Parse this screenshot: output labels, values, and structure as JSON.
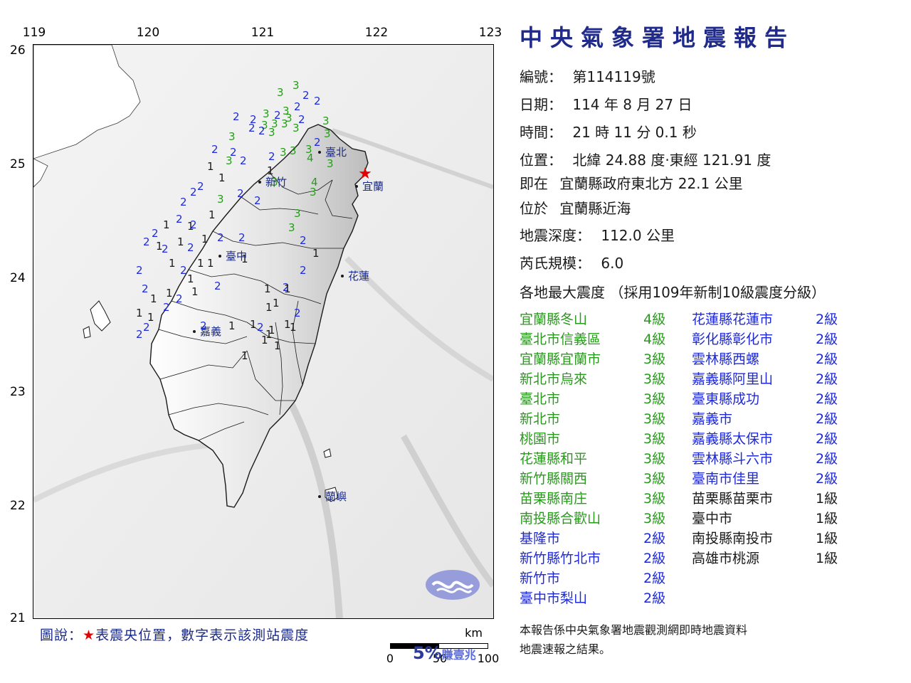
{
  "map": {
    "lon_ticks": [
      "119",
      "120",
      "121",
      "122",
      "123"
    ],
    "lat_ticks": [
      "26",
      "25",
      "24",
      "23",
      "22",
      "21"
    ],
    "caption_prefix": "圖說：",
    "caption_star": "★",
    "caption_text": "表震央位置，數字表示該測站震度",
    "scale_unit": "km",
    "scale_labels": [
      "0",
      "50",
      "100"
    ],
    "cities": [
      "臺北",
      "新竹",
      "宜蘭",
      "臺中",
      "花蓮",
      "嘉義",
      "蘭嶼"
    ],
    "station_values": [
      "3",
      "3",
      "2",
      "2",
      "2",
      "3",
      "3",
      "2",
      "3",
      "2",
      "3",
      "3",
      "3",
      "3",
      "3",
      "2",
      "2",
      "3",
      "2",
      "2",
      "3",
      "3",
      "2",
      "3",
      "3",
      "2",
      "3",
      "4",
      "3",
      "2",
      "2",
      "1",
      "1",
      "3",
      "2",
      "1",
      "2",
      "2",
      "3",
      "2",
      "1",
      "2",
      "2",
      "3",
      "3",
      "3",
      "4",
      "3",
      "1",
      "2",
      "2",
      "1",
      "2",
      "1",
      "1",
      "2",
      "2",
      "1",
      "2",
      "2",
      "1",
      "1",
      "2",
      "2",
      "1",
      "2",
      "1",
      "2",
      "1",
      "2",
      "1",
      "1",
      "2",
      "2",
      "2",
      "2",
      "1",
      "1",
      "1",
      "2",
      "2",
      "2",
      "1",
      "2",
      "1",
      "1",
      "1",
      "1",
      "1",
      "1",
      "2",
      "1",
      "1",
      "1",
      "1",
      "1",
      "1",
      "2",
      "1"
    ],
    "colors": {
      "level1": "#1a1a1a",
      "level2": "#1f2ad6",
      "level3": "#2a9a1e",
      "level4": "#2a9a1e",
      "epicenter": "#e30000"
    }
  },
  "report": {
    "title": "中央氣象署地震報告",
    "number_label": "編號：",
    "number": "第114119號",
    "date_label": "日期：",
    "date": "114 年 8 月 27 日",
    "time_label": "時間：",
    "time": "21 時 11 分 0.1 秒",
    "location_label": "位置：",
    "location": "北緯 24.88 度‧東經 121.91 度",
    "relative_label": "即在",
    "relative": "宜蘭縣政府東北方 22.1 公里",
    "region_label": "位於",
    "region": "宜蘭縣近海",
    "depth_label": "地震深度：",
    "depth": "112.0 公里",
    "magnitude_label": "芮氏規模：",
    "magnitude": "6.0",
    "intensity_title": "各地最大震度 （採用109年新制10級震度分級）",
    "intensities_col1": [
      {
        "place": "宜蘭縣冬山",
        "level": "4級",
        "color": "#2a9a1e"
      },
      {
        "place": "臺北市信義區",
        "level": "4級",
        "color": "#2a9a1e"
      },
      {
        "place": "宜蘭縣宜蘭市",
        "level": "3級",
        "color": "#2a9a1e"
      },
      {
        "place": "新北市烏來",
        "level": "3級",
        "color": "#2a9a1e"
      },
      {
        "place": "臺北市",
        "level": "3級",
        "color": "#2a9a1e"
      },
      {
        "place": "新北市",
        "level": "3級",
        "color": "#2a9a1e"
      },
      {
        "place": "桃園市",
        "level": "3級",
        "color": "#2a9a1e"
      },
      {
        "place": "花蓮縣和平",
        "level": "3級",
        "color": "#2a9a1e"
      },
      {
        "place": "新竹縣關西",
        "level": "3級",
        "color": "#2a9a1e"
      },
      {
        "place": "苗栗縣南庄",
        "level": "3級",
        "color": "#2a9a1e"
      },
      {
        "place": "南投縣合歡山",
        "level": "3級",
        "color": "#2a9a1e"
      },
      {
        "place": "基隆市",
        "level": "2級",
        "color": "#1f2ad6"
      },
      {
        "place": "新竹縣竹北市",
        "level": "2級",
        "color": "#1f2ad6"
      },
      {
        "place": "新竹市",
        "level": "2級",
        "color": "#1f2ad6"
      },
      {
        "place": "臺中市梨山",
        "level": "2級",
        "color": "#1f2ad6"
      }
    ],
    "intensities_col2": [
      {
        "place": "花蓮縣花蓮市",
        "level": "2級",
        "color": "#1f2ad6"
      },
      {
        "place": "彰化縣彰化市",
        "level": "2級",
        "color": "#1f2ad6"
      },
      {
        "place": "雲林縣西螺",
        "level": "2級",
        "color": "#1f2ad6"
      },
      {
        "place": "嘉義縣阿里山",
        "level": "2級",
        "color": "#1f2ad6"
      },
      {
        "place": "臺東縣成功",
        "level": "2級",
        "color": "#1f2ad6"
      },
      {
        "place": "嘉義市",
        "level": "2級",
        "color": "#1f2ad6"
      },
      {
        "place": "嘉義縣太保市",
        "level": "2級",
        "color": "#1f2ad6"
      },
      {
        "place": "雲林縣斗六市",
        "level": "2級",
        "color": "#1f2ad6"
      },
      {
        "place": "臺南市佳里",
        "level": "2級",
        "color": "#1f2ad6"
      },
      {
        "place": "苗栗縣苗栗市",
        "level": "1級",
        "color": "#1a1a1a"
      },
      {
        "place": "臺中市",
        "level": "1級",
        "color": "#1a1a1a"
      },
      {
        "place": "南投縣南投市",
        "level": "1級",
        "color": "#1a1a1a"
      },
      {
        "place": "高雄市桃源",
        "level": "1級",
        "color": "#1a1a1a"
      }
    ],
    "footnote_line1": "本報告係中央氣象署地震觀測網即時地震資料",
    "footnote_line2": "地震速報之結果。"
  },
  "watermark": {
    "big": "5%",
    "small": "賺壹兆"
  }
}
